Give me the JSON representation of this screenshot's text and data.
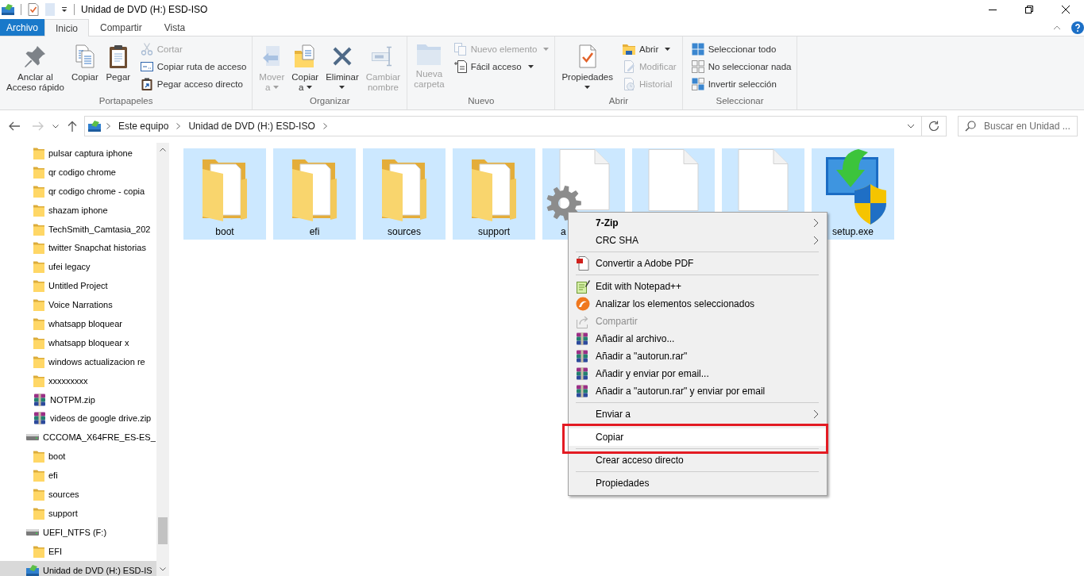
{
  "title_bar": {
    "title": "Unidad de DVD (H:) ESD-ISO"
  },
  "ribbon_tabs": [
    {
      "label": "Archivo",
      "kind": "menu",
      "selected": false
    },
    {
      "label": "Inicio",
      "kind": "tab",
      "selected": true
    },
    {
      "label": "Compartir",
      "kind": "tab",
      "selected": false
    },
    {
      "label": "Vista",
      "kind": "tab",
      "selected": false
    }
  ],
  "ribbon_groups": [
    {
      "label": "Portapapeles",
      "items": [
        {
          "kind": "large",
          "lines": [
            "Anclar al",
            "Acceso rápido"
          ],
          "disabled": false,
          "dropdown": false
        },
        {
          "kind": "large",
          "lines": [
            "Copiar"
          ],
          "disabled": false,
          "dropdown": false
        },
        {
          "kind": "large",
          "lines": [
            "Pegar"
          ],
          "disabled": false,
          "dropdown": false
        },
        {
          "kind": "column",
          "buttons": [
            {
              "label": "Cortar",
              "disabled": true,
              "dropdown": false
            },
            {
              "label": "Copiar ruta de acceso",
              "disabled": false,
              "dropdown": false
            },
            {
              "label": "Pegar acceso directo",
              "disabled": false,
              "dropdown": false
            }
          ]
        }
      ]
    },
    {
      "label": "Organizar",
      "items": [
        {
          "kind": "large",
          "lines": [
            "Mover",
            "a"
          ],
          "disabled": true,
          "dropdown": true
        },
        {
          "kind": "large",
          "lines": [
            "Copiar",
            "a"
          ],
          "disabled": false,
          "dropdown": true
        },
        {
          "kind": "large",
          "lines": [
            "Eliminar"
          ],
          "disabled": false,
          "dropdown": true
        },
        {
          "kind": "large",
          "lines": [
            "Cambiar",
            "nombre"
          ],
          "disabled": true,
          "dropdown": false
        }
      ]
    },
    {
      "label": "Nuevo",
      "items": [
        {
          "kind": "large",
          "lines": [
            "Nueva",
            "carpeta"
          ],
          "disabled": true,
          "dropdown": false
        },
        {
          "kind": "column",
          "buttons": [
            {
              "label": "Nuevo elemento",
              "disabled": true,
              "dropdown": true
            },
            {
              "label": "Fácil acceso",
              "disabled": false,
              "dropdown": true
            }
          ]
        }
      ]
    },
    {
      "label": "Abrir",
      "items": [
        {
          "kind": "large",
          "lines": [
            "Propiedades"
          ],
          "disabled": false,
          "dropdown": true
        },
        {
          "kind": "column",
          "buttons": [
            {
              "label": "Abrir",
              "disabled": false,
              "dropdown": true
            },
            {
              "label": "Modificar",
              "disabled": true,
              "dropdown": false
            },
            {
              "label": "Historial",
              "disabled": true,
              "dropdown": false
            }
          ]
        }
      ]
    },
    {
      "label": "Seleccionar",
      "items": [
        {
          "kind": "column",
          "buttons": [
            {
              "label": "Seleccionar todo",
              "disabled": false,
              "dropdown": false
            },
            {
              "label": "No seleccionar nada",
              "disabled": false,
              "dropdown": false
            },
            {
              "label": "Invertir selección",
              "disabled": false,
              "dropdown": false
            }
          ]
        }
      ]
    }
  ],
  "address_bar": {
    "nav_buttons": [
      {
        "kind": "back",
        "disabled": false
      },
      {
        "kind": "forward",
        "disabled": true
      },
      {
        "kind": "recent",
        "disabled": false
      },
      {
        "kind": "up",
        "disabled": false
      }
    ],
    "breadcrumb": [
      "Este equipo",
      "Unidad de DVD (H:) ESD-ISO"
    ]
  },
  "search": {
    "placeholder": "Buscar en Unidad ..."
  },
  "nav_tree": [
    {
      "children": [
        {
          "label": "pulsar captura iphone",
          "kind": "folder",
          "selected": false
        },
        {
          "label": "qr codigo chrome",
          "kind": "folder",
          "selected": false
        },
        {
          "label": "qr codigo chrome - copia",
          "kind": "folder",
          "selected": false
        },
        {
          "label": "shazam iphone",
          "kind": "folder",
          "selected": false
        },
        {
          "label": "TechSmith_Camtasia_202",
          "kind": "folder",
          "selected": false
        },
        {
          "label": "twitter Snapchat historias",
          "kind": "folder",
          "selected": false
        },
        {
          "label": "ufei legacy",
          "kind": "folder",
          "selected": false
        },
        {
          "label": "Untitled Project",
          "kind": "folder",
          "selected": false
        },
        {
          "label": "Voice Narrations",
          "kind": "folder",
          "selected": false
        },
        {
          "label": "whatsapp bloquear",
          "kind": "folder",
          "selected": false
        },
        {
          "label": "whatsapp bloquear x",
          "kind": "folder",
          "selected": false
        },
        {
          "label": "windows actualizacion re",
          "kind": "folder",
          "selected": false
        },
        {
          "label": "xxxxxxxxx",
          "kind": "folder",
          "selected": false
        },
        {
          "label": "NOTPM.zip",
          "kind": "archive",
          "selected": false
        },
        {
          "label": "videos de google drive.zip",
          "kind": "archive",
          "selected": false
        }
      ]
    },
    {
      "label": "CCCOMA_X64FRE_ES-ES_",
      "kind": "drive",
      "selected": false,
      "children": [
        {
          "label": "boot",
          "kind": "folder",
          "selected": false
        },
        {
          "label": "efi",
          "kind": "folder",
          "selected": false
        },
        {
          "label": "sources",
          "kind": "folder",
          "selected": false
        },
        {
          "label": "support",
          "kind": "folder",
          "selected": false
        }
      ]
    },
    {
      "label": "UEFI_NTFS (F:)",
      "kind": "drive",
      "selected": false,
      "children": [
        {
          "label": "EFI",
          "kind": "folder",
          "selected": false
        }
      ]
    },
    {
      "label": "Unidad de DVD (H:) ESD-IS",
      "kind": "dvd",
      "selected": true
    }
  ],
  "files": [
    {
      "label": "boot",
      "kind": "folder",
      "selected": true
    },
    {
      "label": "efi",
      "kind": "folder",
      "selected": true
    },
    {
      "label": "sources",
      "kind": "folder",
      "selected": true
    },
    {
      "label": "support",
      "kind": "folder",
      "selected": true
    },
    {
      "label": "a",
      "kind": "settings-file",
      "selected": true
    },
    {
      "kind": "file",
      "selected": true
    },
    {
      "kind": "file",
      "selected": true
    },
    {
      "label": "setup.exe",
      "kind": "program",
      "selected": true
    }
  ],
  "context_menu": {
    "items": [
      {
        "kind": "submenu",
        "label": "7-Zip",
        "default": true,
        "disabled": false,
        "selected": false,
        "outlined": false
      },
      {
        "kind": "submenu",
        "label": "CRC SHA",
        "default": false,
        "disabled": false,
        "selected": false,
        "outlined": false
      },
      {
        "kind": "separator"
      },
      {
        "kind": "command",
        "label": "Convertir a Adobe PDF",
        "default": false,
        "disabled": false,
        "selected": false,
        "outlined": false
      },
      {
        "kind": "separator"
      },
      {
        "kind": "command",
        "label": "Edit with Notepad++",
        "default": false,
        "disabled": false,
        "selected": false,
        "outlined": false
      },
      {
        "kind": "command",
        "label": "Analizar los elementos seleccionados",
        "default": false,
        "disabled": false,
        "selected": false,
        "outlined": false
      },
      {
        "kind": "command",
        "label": "Compartir",
        "default": false,
        "disabled": true,
        "selected": false,
        "outlined": false
      },
      {
        "kind": "command",
        "label": "Añadir al archivo...",
        "default": false,
        "disabled": false,
        "selected": false,
        "outlined": false
      },
      {
        "kind": "command",
        "label": "Añadir a \"autorun.rar\"",
        "default": false,
        "disabled": false,
        "selected": false,
        "outlined": false
      },
      {
        "kind": "command",
        "label": "Añadir y enviar por email...",
        "default": false,
        "disabled": false,
        "selected": false,
        "outlined": false
      },
      {
        "kind": "command",
        "label": "Añadir a \"autorun.rar\" y enviar por email",
        "default": false,
        "disabled": false,
        "selected": false,
        "outlined": false
      },
      {
        "kind": "separator"
      },
      {
        "kind": "submenu",
        "label": "Enviar a",
        "default": false,
        "disabled": false,
        "selected": false,
        "outlined": false
      },
      {
        "kind": "separator"
      },
      {
        "kind": "command",
        "label": "Copiar",
        "default": false,
        "disabled": false,
        "selected": true,
        "outlined": true
      },
      {
        "kind": "separator"
      },
      {
        "kind": "command",
        "label": "Crear acceso directo",
        "default": false,
        "disabled": false,
        "selected": false,
        "outlined": false
      },
      {
        "kind": "separator"
      },
      {
        "kind": "command",
        "label": "Propiedades",
        "default": false,
        "disabled": false,
        "selected": false,
        "outlined": false
      }
    ]
  }
}
